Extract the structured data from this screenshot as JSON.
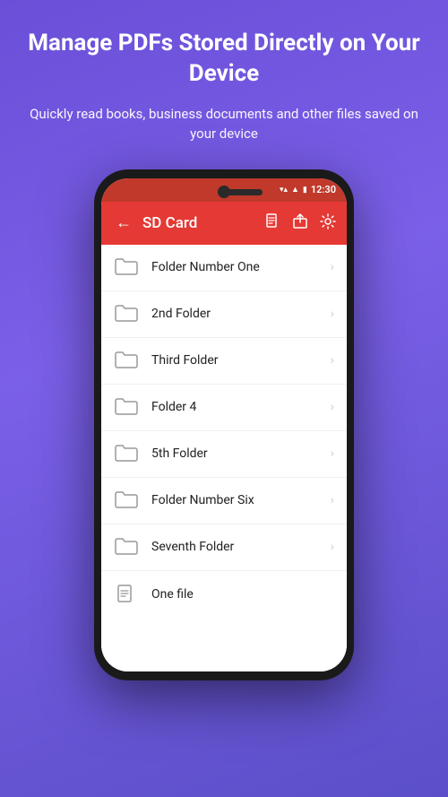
{
  "header": {
    "title": "Manage PDFs Stored Directly on Your Device",
    "subtitle": "Quickly read books, business documents and other files saved on your device"
  },
  "statusBar": {
    "time": "12:30",
    "wifiIcon": "▼",
    "signalIcon": "▲",
    "batteryIcon": "▮"
  },
  "appBar": {
    "backLabel": "←",
    "title": "SD Card",
    "icons": [
      "file",
      "share",
      "settings"
    ]
  },
  "fileList": [
    {
      "name": "Folder Number One",
      "type": "folder"
    },
    {
      "name": "2nd Folder",
      "type": "folder"
    },
    {
      "name": "Third Folder",
      "type": "folder"
    },
    {
      "name": "Folder 4",
      "type": "folder"
    },
    {
      "name": "5th Folder",
      "type": "folder"
    },
    {
      "name": "Folder Number Six",
      "type": "folder"
    },
    {
      "name": "Seventh Folder",
      "type": "folder"
    },
    {
      "name": "One file",
      "type": "file"
    }
  ],
  "colors": {
    "appBarBg": "#e53935",
    "backgroundGradientStart": "#6b4fd8",
    "backgroundGradientEnd": "#5b4fc8"
  }
}
